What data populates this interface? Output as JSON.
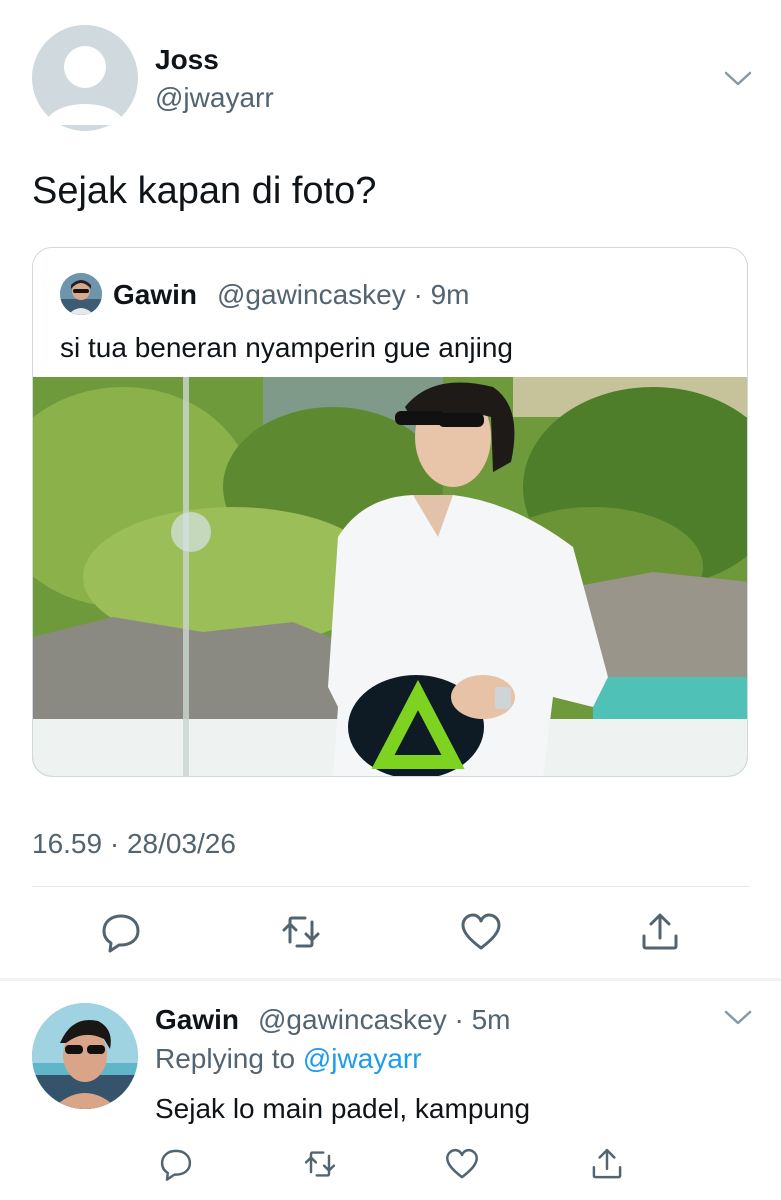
{
  "tweet": {
    "author_name": "Joss",
    "author_handle": "@jwayarr",
    "text": "Sejak kapan di foto?",
    "timestamp": "16.59 · 28/03/26",
    "quote": {
      "author_name": "Gawin",
      "author_handle_time": "@gawincaskey · 9m",
      "text": "si tua beneran nyamperin gue anjing"
    }
  },
  "reply": {
    "author_name": "Gawin",
    "author_handle_time": "@gawincaskey · 5m",
    "replying_prefix": "Replying to ",
    "replying_handle": "@jwayarr",
    "text": "Sejak lo main padel, kampung"
  },
  "icons": [
    "chevron-down-icon",
    "reply-icon",
    "retweet-icon",
    "like-icon",
    "share-icon"
  ],
  "colors": {
    "link": "#1d9bf0",
    "secondary_text": "#536471"
  }
}
